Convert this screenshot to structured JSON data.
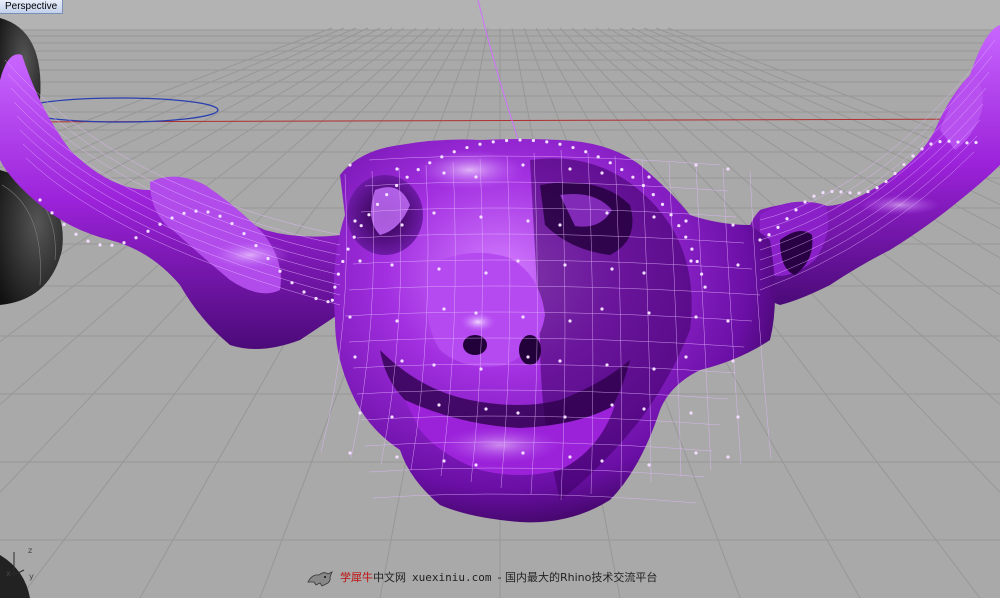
{
  "viewport": {
    "title": "Perspective",
    "background": "#a8a8a8",
    "grid_color": "#9a9a9a",
    "axis_x_color": "#b02020",
    "surface_color": "#9b22d9",
    "control_point_color": "#e6c8ff"
  },
  "axes_icon": {
    "z": "z",
    "x": "x",
    "y": "y"
  },
  "watermark": {
    "logo_icon": "rhino-logo-icon",
    "site_red": "学犀牛",
    "site_dark": "中文网",
    "url": "xuexiniu.com",
    "tagline": "- 国内最大的Rhino技术交流平台"
  }
}
